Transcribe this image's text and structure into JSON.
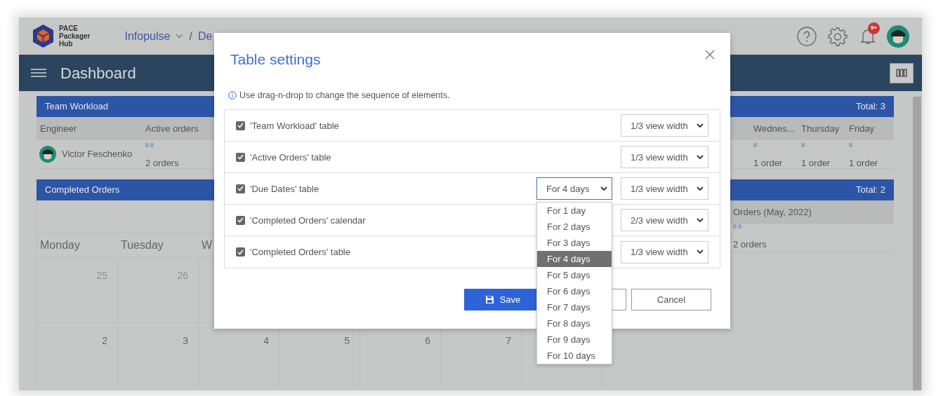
{
  "header": {
    "logo_lines": [
      "PACE",
      "Packager",
      "Hub"
    ],
    "breadcrumb": [
      "Infopulse",
      "De"
    ],
    "breadcrumb_separator": "/",
    "notification_badge": "9+"
  },
  "toolbar": {
    "title": "Dashboard"
  },
  "team_workload": {
    "title": "Team Workload",
    "total": "Total: 3",
    "columns": [
      "Engineer",
      "Active orders",
      "Wednes...",
      "Thursday",
      "Friday"
    ],
    "rows": [
      {
        "cells": [
          {
            "text": "Victor Feschenko",
            "kind": "engineer"
          },
          {
            "text": "2 orders",
            "kind": "pair"
          },
          {
            "text": "1 order",
            "kind": "single"
          },
          {
            "text": "1 order",
            "kind": "single"
          },
          {
            "text": "1 order",
            "kind": "single"
          }
        ]
      }
    ]
  },
  "completed_orders": {
    "title": "Completed Orders",
    "total": "Total: 2",
    "weekdays": [
      "Monday",
      "Tuesday",
      "W"
    ],
    "weeks": [
      [
        {
          "label": "25",
          "muted": true
        },
        {
          "label": "26",
          "muted": true
        }
      ],
      [
        {
          "label": "2",
          "muted": false
        },
        {
          "label": "3",
          "muted": false
        },
        {
          "label": "4",
          "muted": false
        },
        {
          "label": "5",
          "muted": false
        },
        {
          "label": "6",
          "muted": false
        },
        {
          "label": "7",
          "muted": false
        }
      ]
    ],
    "orders_header": "Orders (May, 2022)",
    "orders": [
      {
        "text": "2 orders",
        "kind": "pair"
      }
    ]
  },
  "modal": {
    "title": "Table settings",
    "info": "Use drag-n-drop to change the sequence of elements.",
    "rows": [
      {
        "label": "'Team Workload' table",
        "checked": true,
        "width": "1/3 view width"
      },
      {
        "label": "'Active Orders' table",
        "checked": true,
        "width": "1/3 view width"
      },
      {
        "label": "'Due Dates' table",
        "checked": true,
        "width": "1/3 view width",
        "days": {
          "value": "For 4 days",
          "expanded": true,
          "options": [
            {
              "label": "For 1 day",
              "selected": false
            },
            {
              "label": "For 2 days",
              "selected": false
            },
            {
              "label": "For 3 days",
              "selected": false
            },
            {
              "label": "For 4 days",
              "selected": true
            },
            {
              "label": "For 5 days",
              "selected": false
            },
            {
              "label": "For 6 days",
              "selected": false
            },
            {
              "label": "For 7 days",
              "selected": false
            },
            {
              "label": "For 8 days",
              "selected": false
            },
            {
              "label": "For 9 days",
              "selected": false
            },
            {
              "label": "For 10 days",
              "selected": false
            }
          ]
        }
      },
      {
        "label": "'Completed Orders' calendar",
        "checked": true,
        "width": "2/3 view width"
      },
      {
        "label": "'Completed Orders' table",
        "checked": true,
        "width": "1/3 view width"
      }
    ],
    "buttons": [
      {
        "kind": "primary",
        "label": "Save"
      },
      {
        "kind": "outline"
      },
      {
        "kind": "outline",
        "label": "Cancel"
      }
    ]
  }
}
